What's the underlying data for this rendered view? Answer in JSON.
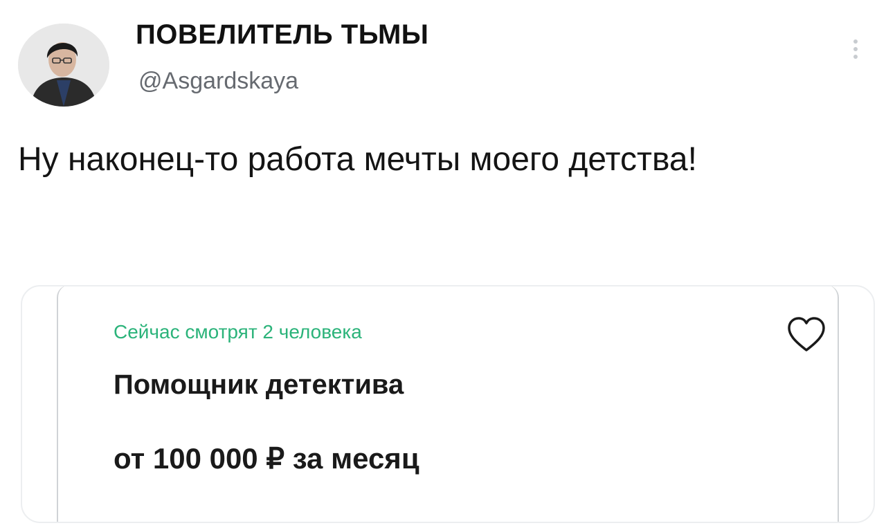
{
  "author": {
    "display_name": "ПОВЕЛИТЕЛЬ ТЬМЫ",
    "handle": "@Asgardskaya",
    "avatar_icon": "user-avatar"
  },
  "tweet": {
    "text": "Ну наконец-то работа мечты моего детства!"
  },
  "menu": {
    "more_icon": "more-vertical-icon"
  },
  "card": {
    "viewers": "Сейчас смотрят 2 человека",
    "title": "Помощник детектива",
    "salary": "от 100 000 ₽ за месяц",
    "favorite_icon": "heart-icon",
    "accent_color": "#2bb37a"
  }
}
